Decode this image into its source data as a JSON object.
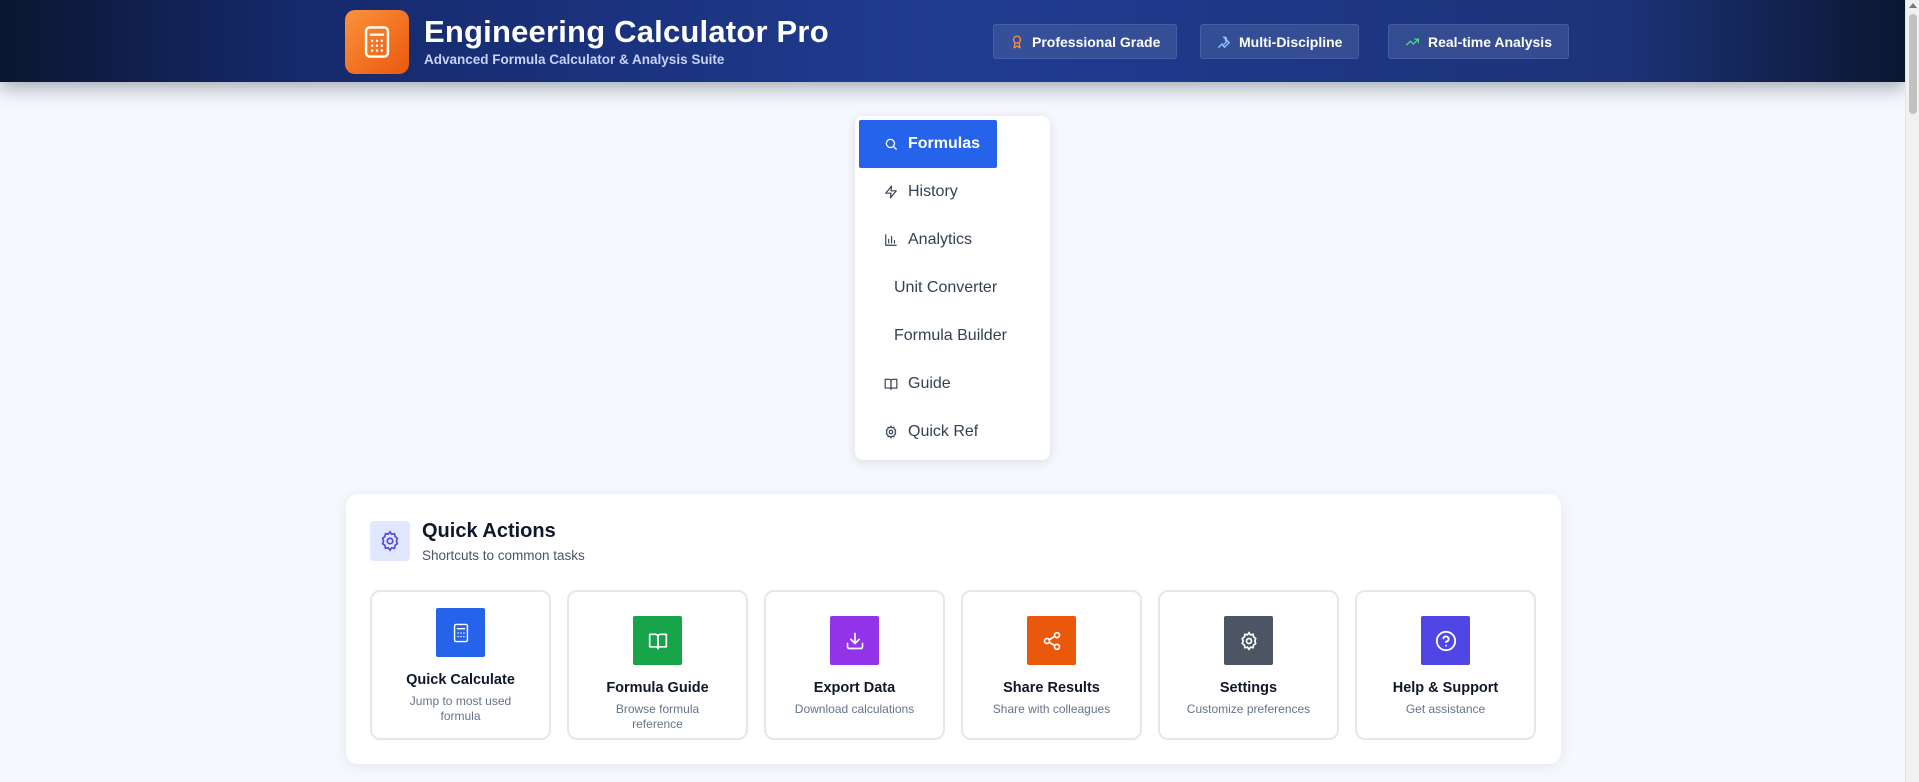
{
  "header": {
    "title": "Engineering Calculator Pro",
    "subtitle": "Advanced Formula Calculator & Analysis Suite",
    "badges": [
      {
        "label": "Professional Grade",
        "icon": "award-icon",
        "color": "#fb923c"
      },
      {
        "label": "Multi-Discipline",
        "icon": "wrench-icon",
        "color": "#93c5fd"
      },
      {
        "label": "Real-time Analysis",
        "icon": "trending-up-icon",
        "color": "#4ade80"
      }
    ]
  },
  "nav": {
    "active": "Formulas",
    "items": [
      {
        "label": "Formulas",
        "icon": "search-icon"
      },
      {
        "label": "History",
        "icon": "zap-icon"
      },
      {
        "label": "Analytics",
        "icon": "bar-chart-icon"
      },
      {
        "label": "Unit Converter",
        "icon": "arrows-swap-icon"
      },
      {
        "label": "Formula Builder",
        "icon": "code-icon"
      },
      {
        "label": "Guide",
        "icon": "book-open-icon"
      },
      {
        "label": "Quick Ref",
        "icon": "gear-icon"
      }
    ]
  },
  "quick_actions": {
    "title": "Quick Actions",
    "subtitle": "Shortcuts to common tasks",
    "cards": [
      {
        "title": "Quick Calculate",
        "desc": "Jump to most used formula",
        "icon": "calculator-icon",
        "color": "#2563eb"
      },
      {
        "title": "Formula Guide",
        "desc": "Browse formula reference",
        "icon": "book-open-icon",
        "color": "#16a34a"
      },
      {
        "title": "Export Data",
        "desc": "Download calculations",
        "icon": "download-icon",
        "color": "#9333ea"
      },
      {
        "title": "Share Results",
        "desc": "Share with colleagues",
        "icon": "share-icon",
        "color": "#ea580c"
      },
      {
        "title": "Settings",
        "desc": "Customize preferences",
        "icon": "gear-icon",
        "color": "#4b5563"
      },
      {
        "title": "Help & Support",
        "desc": "Get assistance",
        "icon": "help-circle-icon",
        "color": "#4f46e5"
      }
    ]
  },
  "colors": {
    "accent": "#2563eb",
    "brand_orange": "#f97316",
    "header_bg": "#1e3a8a",
    "page_bg": "#f5f8fd"
  }
}
